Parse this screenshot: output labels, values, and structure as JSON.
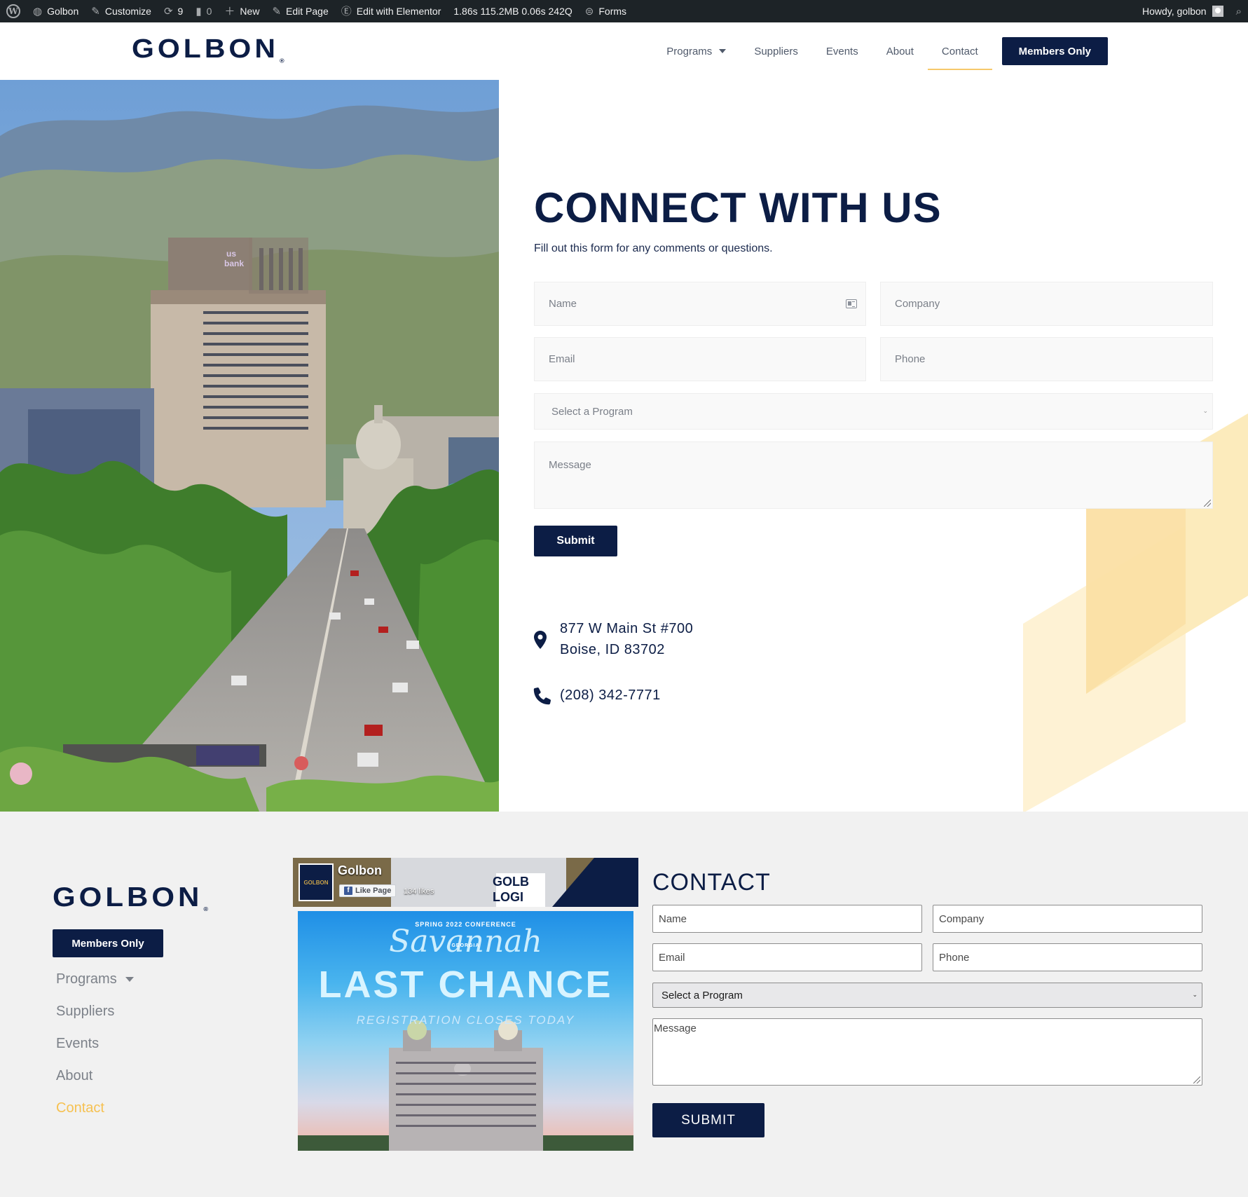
{
  "admin_bar": {
    "site": "Golbon",
    "customize": "Customize",
    "updates": "9",
    "comments": "0",
    "new": "New",
    "edit_page": "Edit Page",
    "elementor": "Edit with Elementor",
    "stats": "1.86s  115.2MB  0.06s  242Q",
    "forms": "Forms",
    "howdy": "Howdy, golbon"
  },
  "header": {
    "logo": "GOLBON",
    "nav": [
      "Programs",
      "Suppliers",
      "Events",
      "About",
      "Contact"
    ],
    "active_nav": "Contact",
    "members_button": "Members Only"
  },
  "hero": {
    "title": "CONNECT WITH US",
    "subtitle": "Fill out this form for any comments or questions.",
    "fields": {
      "name": "Name",
      "company": "Company",
      "email": "Email",
      "phone": "Phone",
      "program": "Select a Program",
      "message": "Message"
    },
    "submit": "Submit",
    "address_line1": "877 W Main St #700",
    "address_line2": "Boise, ID 83702",
    "phone": "(208) 342-7771"
  },
  "footer": {
    "logo": "GOLBON",
    "members_button": "Members Only",
    "nav": [
      "Programs",
      "Suppliers",
      "Events",
      "About",
      "Contact"
    ],
    "active_nav": "Contact",
    "facebook": {
      "page_name": "Golbon",
      "like_button": "Like Page",
      "likes": "134 likes"
    },
    "promo": {
      "overline": "SPRING 2022 CONFERENCE",
      "script": "Savannah",
      "state": "GEORGIA",
      "headline": "LAST CHANCE",
      "subline": "REGISTRATION CLOSES TODAY"
    },
    "contact": {
      "title": "CONTACT",
      "fields": {
        "name": "Name",
        "company": "Company",
        "email": "Email",
        "phone": "Phone",
        "program": "Select a Program",
        "message": "Message"
      },
      "submit": "SUBMIT"
    }
  },
  "colors": {
    "navy": "#0c1d45",
    "accent": "#f6c151",
    "admin_bar": "#1d2327",
    "footer_bg": "#f1f1f1"
  }
}
